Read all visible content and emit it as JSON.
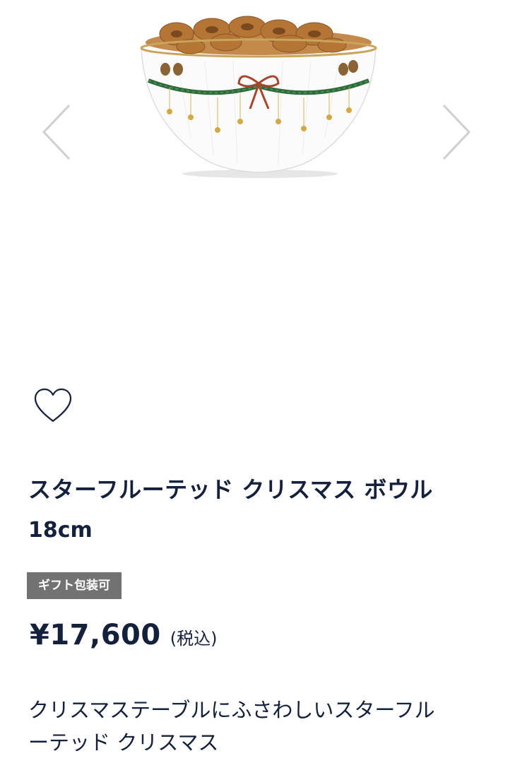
{
  "product": {
    "title": "スターフルーテッド クリスマス ボウル",
    "size": "18cm",
    "badge": "ギフト包装可",
    "price": "¥17,600",
    "tax_note": "(税込)",
    "description_line1": "クリスマステーブルにふさわしいスターフル",
    "description_line2": "ーテッド クリスマス"
  },
  "icons": {
    "prev": "chevron-left-icon",
    "next": "chevron-right-icon",
    "favorite": "heart-outline-icon"
  },
  "colors": {
    "text": "#14213d",
    "badge_bg": "#727272",
    "arrow": "#cfcfcf"
  }
}
